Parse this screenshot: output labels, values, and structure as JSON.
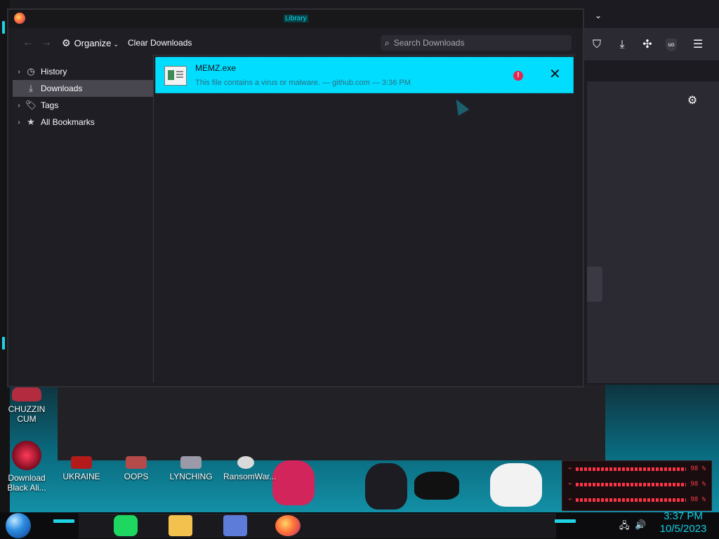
{
  "library": {
    "title": "Library",
    "toolbar": {
      "organize": "Organize",
      "clear_downloads": "Clear Downloads",
      "search_placeholder": "Search Downloads"
    },
    "sidebar": {
      "items": [
        {
          "label": "History",
          "icon": "clock-icon",
          "expandable": true,
          "selected": false
        },
        {
          "label": "Downloads",
          "icon": "download-icon",
          "expandable": false,
          "selected": true
        },
        {
          "label": "Tags",
          "icon": "tag-icon",
          "expandable": true,
          "selected": false
        },
        {
          "label": "All Bookmarks",
          "icon": "star-icon",
          "expandable": true,
          "selected": false
        }
      ]
    },
    "downloads": [
      {
        "file": "MEMZ.exe",
        "status": "This file contains a virus or malware. — github.com — 3:36 PM",
        "warning": "!"
      }
    ]
  },
  "desktop_icons": [
    {
      "label": "CHUZZIN CUM"
    },
    {
      "label": "Download Black Ali..."
    },
    {
      "label": "UKRAINE"
    },
    {
      "label": "OOPS"
    },
    {
      "label": "LYNCHING"
    },
    {
      "label": "RansomWar..."
    }
  ],
  "hud": {
    "rows": [
      "98 %",
      "98 %",
      "98 %"
    ]
  },
  "taskbar": {
    "time": "3:37 PM",
    "date": "10/5/2023"
  },
  "colors": {
    "accent": "#00ddff",
    "warning": "#e22850",
    "clock": "#14cfe3"
  }
}
